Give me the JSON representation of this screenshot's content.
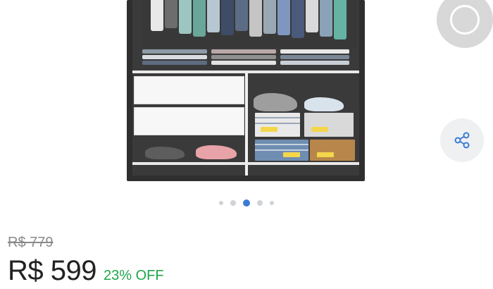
{
  "product": {
    "image_alt": "wardrobe",
    "gallery": {
      "total": 5,
      "active_index": 2
    }
  },
  "price": {
    "old": "R$ 779",
    "current": "R$ 599",
    "discount": "23% OFF"
  },
  "actions": {
    "record_icon": "circle-record-icon",
    "share_icon": "share-icon"
  },
  "colors": {
    "accent": "#3a7bd5",
    "discount": "#1ea54b",
    "old_price": "#8a8a8a",
    "dot_inactive": "#cfd3d7"
  }
}
